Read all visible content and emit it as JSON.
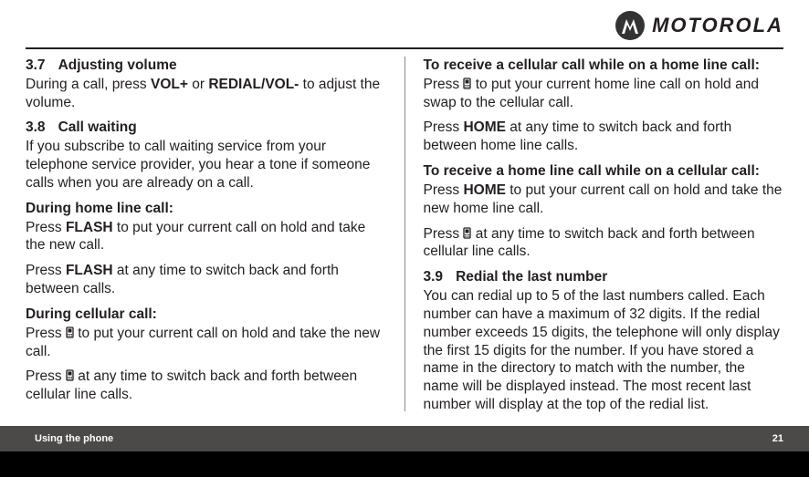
{
  "brand": "MOTOROLA",
  "sections": {
    "s37": {
      "num": "3.7",
      "title": "Adjusting volume"
    },
    "s38": {
      "num": "3.8",
      "title": "Call waiting"
    },
    "s39": {
      "num": "3.9",
      "title": "Redial the last number"
    }
  },
  "col1": {
    "p1a": "During a call, press ",
    "p1b": "VOL+",
    "p1c": " or ",
    "p1d": "REDIAL/VOL-",
    "p1e": " to adjust the volume.",
    "p2": "If you subscribe to call waiting service from your telephone service provider, you hear a tone if someone calls when you are already on a call.",
    "h1": "During home line call:",
    "p3a": "Press ",
    "p3b": "FLASH",
    "p3c": " to put your current call on hold and take the new call.",
    "p4a": "Press ",
    "p4b": "FLASH",
    "p4c": " at any time to switch back and forth between calls.",
    "h2": "During cellular call:",
    "p5a": "Press ",
    "p5b": " to put your current call on hold and take the new call.",
    "p6a": "Press ",
    "p6b": " at any time to switch back and forth between cellular line calls."
  },
  "col2": {
    "h1": "To receive a cellular call while on a home line call:",
    "p1a": "Press ",
    "p1b": " to put your current home line call on hold and swap to the cellular call.",
    "p2a": "Press ",
    "p2b": "HOME",
    "p2c": " at any time to switch back and forth between home line calls.",
    "h2": "To receive a home line call while on a cellular call:",
    "p3a": "Press ",
    "p3b": "HOME",
    "p3c": " to put your current call on hold and take the new home line call.",
    "p4a": "Press ",
    "p4b": " at any time to switch back and forth between cellular line calls.",
    "p5": "You can redial up to 5 of the last numbers called. Each number can have a maximum of 32 digits. If the redial number exceeds 15 digits, the telephone will only display the first 15 digits for the number. If you have stored a name in the directory to match with the number, the name will be displayed instead. The most recent last number will display at the top of the redial list."
  },
  "footer": {
    "left": "Using the phone",
    "right": "21"
  }
}
